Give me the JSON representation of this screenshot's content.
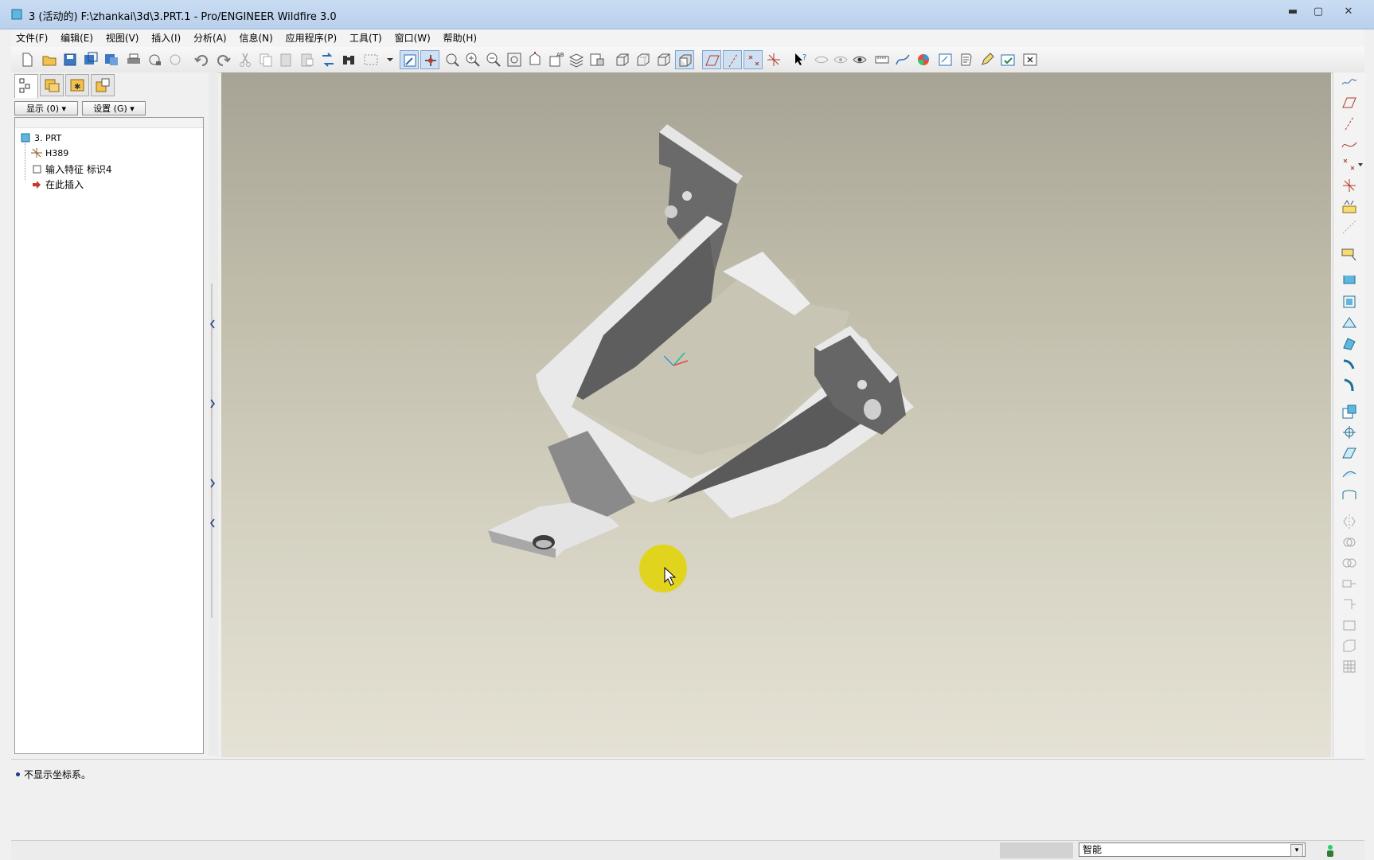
{
  "window": {
    "title": "3 (活动的) F:\\zhankai\\3d\\3.PRT.1 - Pro/ENGINEER Wildfire 3.0",
    "minimize": "▬",
    "maximize": "▢",
    "close": "✕"
  },
  "menu": {
    "items": [
      "文件(F)",
      "编辑(E)",
      "视图(V)",
      "插入(I)",
      "分析(A)",
      "信息(N)",
      "应用程序(P)",
      "工具(T)",
      "窗口(W)",
      "帮助(H)"
    ]
  },
  "left_panel": {
    "show_button": "显示 (0) ▾",
    "settings_button": "设置 (G) ▾",
    "tree": {
      "root": "3. PRT",
      "items": [
        "H389",
        "输入特征  标识4",
        "在此插入"
      ]
    }
  },
  "messages": {
    "line1": "不显示坐标系。"
  },
  "status": {
    "filter_value": "智能",
    "filter_arrow": "▾"
  },
  "colors": {
    "accent": "#cfe0f2",
    "part_light": "#ececec",
    "part_dark": "#5e5e5e",
    "cursor_highlight": "#e3d400"
  }
}
